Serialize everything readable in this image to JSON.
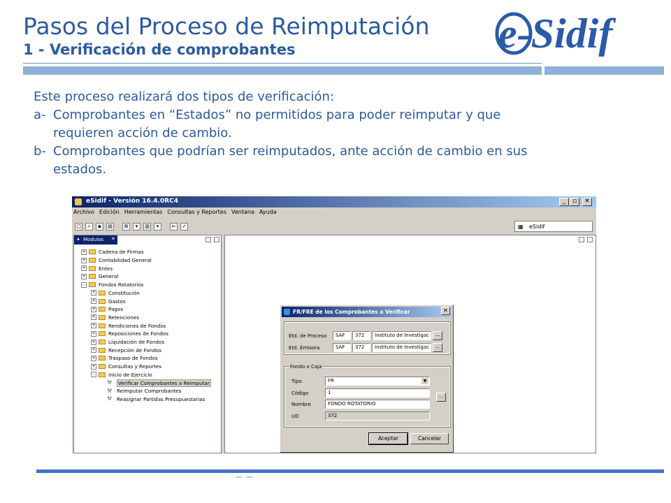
{
  "slide": {
    "title": "Pasos del Proceso de Reimputación",
    "subtitle": "1 - Verificación de comprobantes",
    "intro": "Este proceso realizará dos tipos de verificación:",
    "items": [
      {
        "marker": "a-",
        "line1": "Comprobantes en “Estados” no permitidos para poder reimputar y que",
        "line2": "requieren acción de cambio."
      },
      {
        "marker": "b-",
        "line1": "Comprobantes que podrían ser reimputados, ante acción de cambio en sus",
        "line2": "estados."
      }
    ]
  },
  "logo": {
    "text": "e-Sidif",
    "color": "#2a5aa8"
  },
  "colors": {
    "title": "#2c5a9e",
    "bar": "#8fb0d8",
    "foot": "#4472c4"
  },
  "app": {
    "window_title": "eSidif - Versión 16.4.0RC4",
    "menu": [
      "Archivo",
      "Edición",
      "Herramientas",
      "Consultas y Reportes",
      "Ventana",
      "Ayuda"
    ],
    "perspective": "eSidif",
    "modules_tab": "Modulos",
    "tree": [
      {
        "label": "Cadena de Firmas",
        "level": 0,
        "type": "folder",
        "exp": "+"
      },
      {
        "label": "Contabilidad General",
        "level": 0,
        "type": "folder",
        "exp": "+"
      },
      {
        "label": "Entes",
        "level": 0,
        "type": "folder",
        "exp": "+"
      },
      {
        "label": "General",
        "level": 0,
        "type": "folder",
        "exp": "+"
      },
      {
        "label": "Fondos Rotatorios",
        "level": 0,
        "type": "folder",
        "exp": "-"
      },
      {
        "label": "Constitución",
        "level": 1,
        "type": "folder",
        "exp": "+"
      },
      {
        "label": "Gastos",
        "level": 1,
        "type": "folder",
        "exp": "+"
      },
      {
        "label": "Pagos",
        "level": 1,
        "type": "folder",
        "exp": "+"
      },
      {
        "label": "Retenciones",
        "level": 1,
        "type": "folder",
        "exp": "+"
      },
      {
        "label": "Rendiciones de Fondos",
        "level": 1,
        "type": "folder",
        "exp": "+"
      },
      {
        "label": "Reposiciones de Fondos",
        "level": 1,
        "type": "folder",
        "exp": "+"
      },
      {
        "label": "Liquidación de Fondos",
        "level": 1,
        "type": "folder",
        "exp": "+"
      },
      {
        "label": "Recepción de Fondos",
        "level": 1,
        "type": "folder",
        "exp": "+"
      },
      {
        "label": "Traspaso de Fondos",
        "level": 1,
        "type": "folder",
        "exp": "+"
      },
      {
        "label": "Consultas y Reportes",
        "level": 1,
        "type": "folder",
        "exp": "+"
      },
      {
        "label": "Inicio de Ejercicio",
        "level": 1,
        "type": "folder",
        "exp": "-"
      },
      {
        "label": "Verificar Comprobantes a Reimputar",
        "level": 2,
        "type": "tool",
        "exp": "",
        "selected": true
      },
      {
        "label": "Reimputar Comprobantes",
        "level": 2,
        "type": "tool",
        "exp": ""
      },
      {
        "label": "Reasignar Partidas Presupuestarias",
        "level": 2,
        "type": "tool",
        "exp": ""
      }
    ],
    "dialog": {
      "title": "FR/FRE de los Comprobantes a Verificar",
      "etd_proceso_label": "Etd. de Proceso",
      "etd_emisora_label": "Etd. Emisora",
      "saf": "SAF",
      "num": "372",
      "instituto": "Instituto de Investigac",
      "ellipsis": "...",
      "group_label": "Fondo o Caja",
      "tipo_label": "Tipo",
      "tipo_value": "FR",
      "codigo_label": "Código",
      "codigo_value": "1",
      "nombre_label": "Nombre",
      "nombre_value": "FONDO ROTATORIO",
      "ud_label": "UD",
      "ud_value": "372",
      "accept": "Aceptar",
      "cancel": "Cancelar"
    }
  }
}
